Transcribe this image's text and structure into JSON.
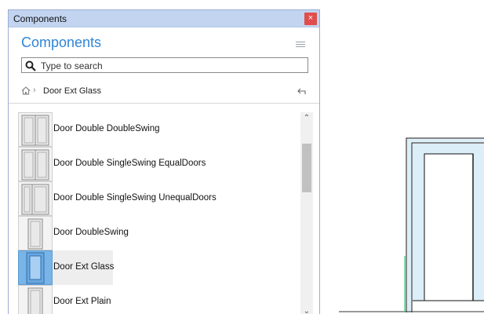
{
  "window": {
    "title": "Components"
  },
  "panel": {
    "heading": "Components"
  },
  "search": {
    "placeholder": "Type to search"
  },
  "breadcrumb": {
    "current": "Door Ext Glass"
  },
  "list": {
    "items": [
      {
        "label": "Door Double DoubleSwing",
        "thumb": "double-door",
        "selected": false
      },
      {
        "label": "Door Double SingleSwing EqualDoors",
        "thumb": "double-door",
        "selected": false
      },
      {
        "label": "Door Double SingleSwing UnequalDoors",
        "thumb": "double-door-unequal",
        "selected": false
      },
      {
        "label": "Door DoubleSwing",
        "thumb": "single-door",
        "selected": false
      },
      {
        "label": "Door Ext Glass",
        "thumb": "glass-door",
        "selected": true
      },
      {
        "label": "Door Ext Plain",
        "thumb": "single-door",
        "selected": false
      }
    ]
  },
  "icons": {
    "close": "close-icon",
    "menu": "hamburger-menu-icon",
    "search": "magnifier-icon",
    "home": "home-icon",
    "back": "back-arrow-icon",
    "scroll_up": "chevron-up-icon",
    "scroll_down": "chevron-down-icon"
  },
  "colors": {
    "titlebar": "#c3d4f0",
    "heading": "#2f86d6",
    "close": "#e04d4d",
    "selection": "#7ab4e6",
    "door_fill": "#dceef8"
  }
}
